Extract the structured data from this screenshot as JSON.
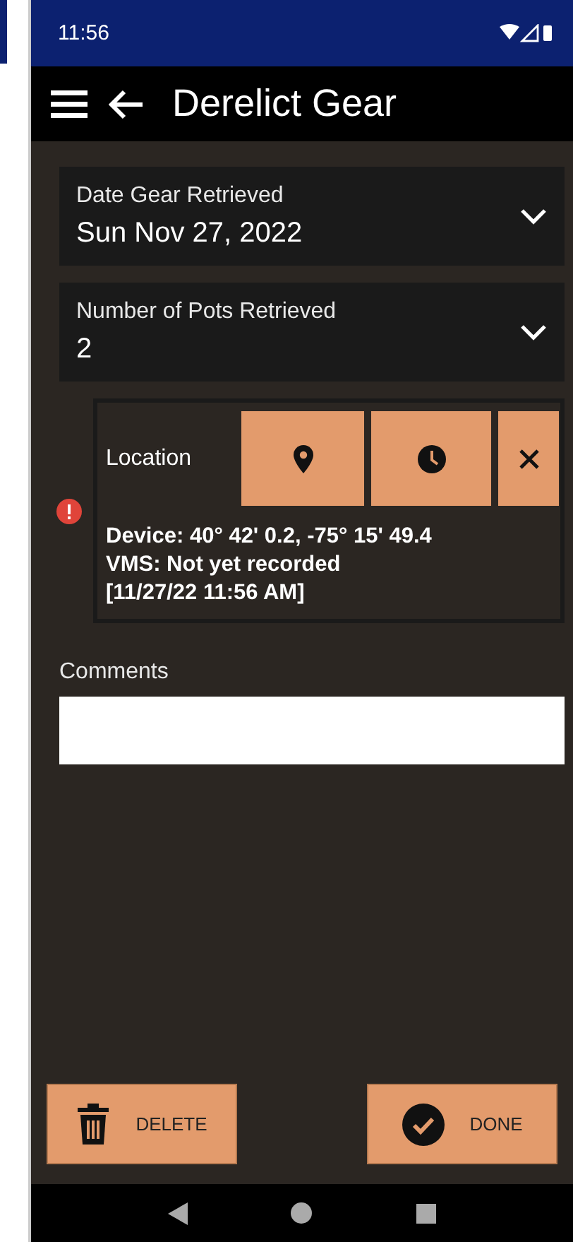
{
  "status_bar": {
    "time": "11:56"
  },
  "app_bar": {
    "title": "Derelict Gear"
  },
  "fields": [
    {
      "label": "Date Gear Retrieved",
      "value": "Sun Nov 27, 2022"
    },
    {
      "label": "Number of Pots Retrieved",
      "value": "2"
    }
  ],
  "location": {
    "label": "Location",
    "error": true,
    "lines": [
      "Device: 40° 42' 0.2, -75° 15' 49.4",
      "VMS: Not yet recorded",
      "[11/27/22 11:56 AM]"
    ]
  },
  "comments": {
    "label": "Comments"
  },
  "buttons": [
    {
      "kind": "delete",
      "label": "DELETE"
    },
    {
      "kind": "done",
      "label": "DONE"
    }
  ]
}
